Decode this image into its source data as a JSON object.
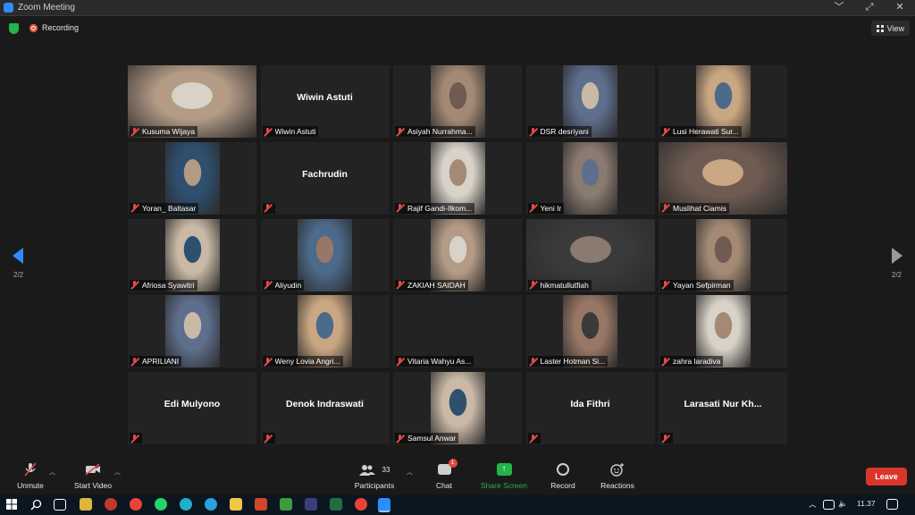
{
  "window": {
    "title": "Zoom Meeting",
    "controls": [
      "﹀",
      "⤢",
      "✕"
    ]
  },
  "topbar": {
    "recording_label": "Recording",
    "view_label": "View"
  },
  "nav": {
    "page_left": "2/2",
    "page_right": "2/2"
  },
  "participants": [
    {
      "name": "Kusuma Wijaya",
      "video": true
    },
    {
      "name": "Wiwin Astuti",
      "video": false,
      "title": "Wiwin Astuti"
    },
    {
      "name": "Asiyah Nurrahma...",
      "video": true
    },
    {
      "name": "DSR desriyani",
      "video": true
    },
    {
      "name": "Lusi Herawati Sur...",
      "video": true
    },
    {
      "name": "Yoran_ Baltasar",
      "video": true
    },
    {
      "name": "",
      "video": false,
      "title": "Fachrudin"
    },
    {
      "name": "Rajif Gandi-Ilkom...",
      "video": true
    },
    {
      "name": "Yeni Ir",
      "video": true
    },
    {
      "name": "Muslihat Ciamis",
      "video": true
    },
    {
      "name": "Afriosa Syawitri",
      "video": true
    },
    {
      "name": "Aliyudin",
      "video": true
    },
    {
      "name": "ZAKIAH SAIDAH",
      "video": true
    },
    {
      "name": "hikmatullutfiah",
      "video": true
    },
    {
      "name": "Yayan Sefpirman",
      "video": true
    },
    {
      "name": "APRILIANI",
      "video": true
    },
    {
      "name": "Weny Lovia Angri...",
      "video": true
    },
    {
      "name": "Vitaria Wahyu As...",
      "video": false
    },
    {
      "name": "Laster Hotman Si...",
      "video": true
    },
    {
      "name": "zahra laradiva",
      "video": true
    },
    {
      "name": "",
      "video": false,
      "title": "Edi Mulyono"
    },
    {
      "name": "",
      "video": false,
      "title": "Denok Indraswati"
    },
    {
      "name": "Samsul Anwar",
      "video": true
    },
    {
      "name": "",
      "video": false,
      "title": "Ida Fithri"
    },
    {
      "name": "",
      "video": false,
      "title": "Larasati Nur Kh..."
    }
  ],
  "toolbar": {
    "unmute": "Unmute",
    "start_video": "Start Video",
    "participants_label": "Participants",
    "participants_count": "33",
    "chat": "Chat",
    "chat_badge": "1",
    "share_screen": "Share Screen",
    "record": "Record",
    "reactions": "Reactions",
    "leave": "Leave"
  },
  "taskbar": {
    "time": "11.37"
  },
  "colors": {
    "accent": "#2d8cff",
    "leave": "#d9352a",
    "share": "#23b34a",
    "muted": "#e24a4a",
    "tile": "#232323"
  }
}
